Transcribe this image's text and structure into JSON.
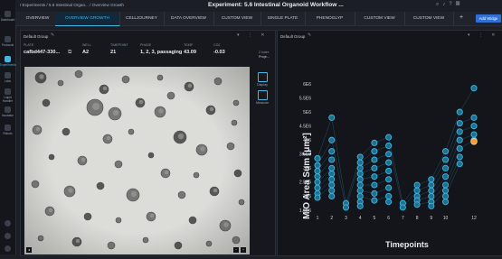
{
  "rail": {
    "items": [
      {
        "label": "Dashboard",
        "icon": "grid-icon"
      },
      {
        "label": "Protocols",
        "icon": "clipboard-icon"
      },
      {
        "label": "Experiments",
        "icon": "flask-icon",
        "active": true
      },
      {
        "label": "Labs",
        "icon": "lab-icon"
      },
      {
        "label": "Liquid Handler",
        "icon": "drop-icon"
      },
      {
        "label": "Incubator",
        "icon": "incubator-icon"
      },
      {
        "label": "Robots",
        "icon": "robot-icon"
      }
    ],
    "bottom": [
      "help-icon",
      "settings-icon",
      "user-icon"
    ]
  },
  "header": {
    "breadcrumb": "/ Experiments / 5.6 Intestinal Organ... / Overview Growth",
    "title": "Experiment: 5.6 Intestinal Organoid Workflow ...",
    "add_widget": "Add Widge"
  },
  "tabs": [
    "OVERVIEW",
    "OVERVIEW GROWTH",
    "CELLJOURNEY",
    "DATA OVERVIEW",
    "CUSTOM VIEW",
    "SINGLE PLATE",
    "PHENOGLYP",
    "CUSTOM VIEW",
    "CUSTOM VIEW"
  ],
  "left_panel": {
    "group": "Default Group",
    "plate_label": "PLATE",
    "plate": "cafbd447-330...",
    "well_label": "WELL",
    "well": "A2",
    "timepoint_label": "TIMEPOINT",
    "timepoint": "21",
    "phase_label": "PHASE",
    "phase": "1, 2, 3, passaging",
    "temp_label": "TEMP",
    "temp": "43.09",
    "co2_label": "CO2",
    "co2": "-0.03",
    "zoom_label": "Z Index",
    "zoom_value": "Proje...",
    "tools": [
      "Display",
      "Measure"
    ]
  },
  "right_panel": {
    "group": "Default Group"
  },
  "chart_data": {
    "type": "scatter",
    "xlabel": "Timepoints",
    "ylabel": "MIO Area Sum [μm²]",
    "x_ticks": [
      1,
      2,
      3,
      4,
      5,
      6,
      7,
      8,
      9,
      10,
      12
    ],
    "y_ticks": [
      "1.5E6",
      "2E6",
      "2.5E6",
      "3E6",
      "3.5E6",
      "4E6",
      "4.5E6",
      "5E6",
      "5.5E6",
      "6E6"
    ],
    "ylim": [
      1500000,
      6000000
    ],
    "grid": false,
    "marker_color": "#3fb8e6",
    "highlight_color": "#f0a040",
    "series": [
      {
        "points": [
          [
            1,
            3.35
          ],
          [
            1,
            3.1
          ],
          [
            1,
            2.9
          ],
          [
            1,
            2.7
          ],
          [
            1,
            2.5
          ],
          [
            1,
            2.3
          ],
          [
            1,
            2.1
          ],
          [
            1,
            1.95
          ],
          [
            2,
            4.8
          ],
          [
            2,
            4.0
          ],
          [
            2,
            3.6
          ],
          [
            2,
            3.3
          ],
          [
            2,
            3.0
          ],
          [
            2,
            2.8
          ],
          [
            2,
            2.6
          ],
          [
            2,
            2.4
          ],
          [
            2,
            2.2
          ],
          [
            2,
            2.0
          ],
          [
            3,
            1.75
          ],
          [
            3,
            1.6
          ],
          [
            4,
            3.4
          ],
          [
            4,
            3.2
          ],
          [
            4,
            3.0
          ],
          [
            4,
            2.8
          ],
          [
            4,
            2.6
          ],
          [
            4,
            2.4
          ],
          [
            4,
            2.2
          ],
          [
            4,
            2.0
          ],
          [
            4,
            1.8
          ],
          [
            4,
            1.65
          ],
          [
            5,
            3.9
          ],
          [
            5,
            3.6
          ],
          [
            5,
            3.3
          ],
          [
            5,
            3.0
          ],
          [
            5,
            2.7
          ],
          [
            5,
            2.4
          ],
          [
            5,
            2.1
          ],
          [
            5,
            1.85
          ],
          [
            6,
            4.1
          ],
          [
            6,
            3.8
          ],
          [
            6,
            3.5
          ],
          [
            6,
            3.2
          ],
          [
            6,
            2.9
          ],
          [
            6,
            2.6
          ],
          [
            6,
            2.3
          ],
          [
            6,
            2.0
          ],
          [
            6,
            1.8
          ],
          [
            7,
            1.75
          ],
          [
            7,
            1.6
          ],
          [
            8,
            2.4
          ],
          [
            8,
            2.2
          ],
          [
            8,
            2.0
          ],
          [
            8,
            1.85
          ],
          [
            8,
            1.7
          ],
          [
            9,
            2.6
          ],
          [
            9,
            2.4
          ],
          [
            9,
            2.2
          ],
          [
            9,
            2.0
          ],
          [
            9,
            1.8
          ],
          [
            9,
            1.65
          ],
          [
            10,
            3.6
          ],
          [
            10,
            3.3
          ],
          [
            10,
            3.0
          ],
          [
            10,
            2.7
          ],
          [
            10,
            2.4
          ],
          [
            10,
            2.2
          ],
          [
            10,
            2.0
          ],
          [
            10,
            1.8
          ],
          [
            11,
            5.0
          ],
          [
            11,
            4.6
          ],
          [
            11,
            4.3
          ],
          [
            11,
            4.0
          ],
          [
            11,
            3.7
          ],
          [
            11,
            3.4
          ],
          [
            11,
            3.15
          ],
          [
            12,
            5.85
          ],
          [
            12,
            4.8
          ],
          [
            12,
            4.5
          ],
          [
            12,
            4.2
          ],
          [
            12,
            4.0
          ]
        ]
      },
      {
        "highlight": [
          [
            12,
            3.95
          ]
        ]
      }
    ]
  }
}
